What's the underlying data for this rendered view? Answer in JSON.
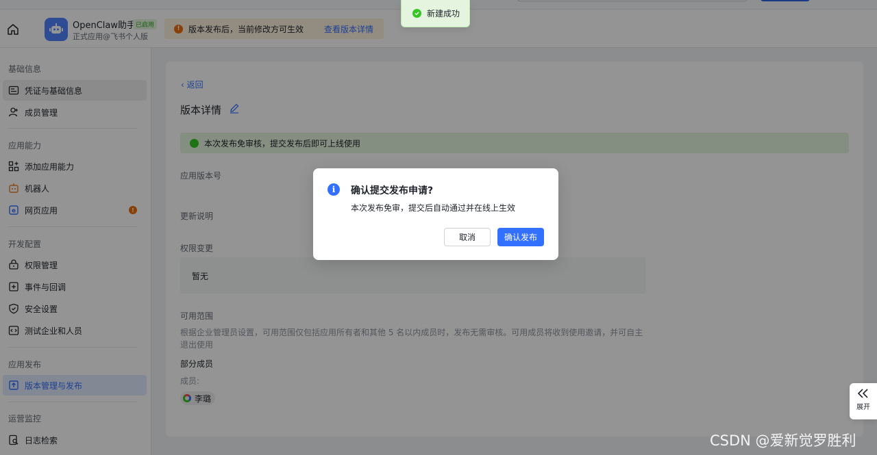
{
  "app": {
    "name": "OpenClaw助手",
    "status_badge": "已启用",
    "subtitle": "正式应用@飞书个人版"
  },
  "notice": {
    "text": "版本发布后，当前修改方可生效",
    "link": "查看版本详情"
  },
  "toast": {
    "text": "新建成功"
  },
  "sidebar": {
    "sections": [
      {
        "title": "基础信息",
        "items": [
          "凭证与基础信息",
          "成员管理"
        ]
      },
      {
        "title": "应用能力",
        "items": [
          "添加应用能力",
          "机器人",
          "网页应用"
        ]
      },
      {
        "title": "开发配置",
        "items": [
          "权限管理",
          "事件与回调",
          "安全设置",
          "测试企业和人员"
        ]
      },
      {
        "title": "应用发布",
        "items": [
          "版本管理与发布"
        ]
      },
      {
        "title": "运营监控",
        "items": [
          "日志检索"
        ]
      }
    ],
    "warning_glyph": "!"
  },
  "main": {
    "back": "返回",
    "title": "版本详情",
    "success_notice": "本次发布免审核，提交发布后即可上线使用",
    "version_label": "应用版本号",
    "update_label": "更新说明",
    "permission_label": "权限变更",
    "permission_value": "暂无",
    "scope_label": "可用范围",
    "scope_desc": "根据企业管理员设置，可用范围仅包括应用所有者和其他 5 名以内成员时，发布无需审核。可用成员将收到使用邀请，并可自主退出使用",
    "scope_type": "部分成员",
    "members_label": "成员:",
    "member_name": "李璐"
  },
  "modal": {
    "title": "确认提交发布申请?",
    "content": "本次发布免审，提交后自动通过并在线上生效",
    "cancel": "取消",
    "confirm": "确认发布",
    "info_glyph": "i"
  },
  "expand": {
    "label": "展开"
  },
  "watermark": "CSDN @爱新觉罗胜利",
  "colors": {
    "accent": "#3370ff",
    "success": "#34c724",
    "warning": "#ed6d0c"
  }
}
